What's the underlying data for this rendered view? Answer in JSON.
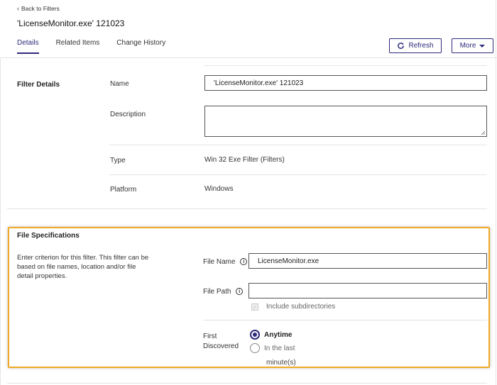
{
  "nav": {
    "back_label": "Back to Filters"
  },
  "page": {
    "title": "'LicenseMonitor.exe' 121023"
  },
  "tabs": [
    {
      "label": "Details",
      "active": true
    },
    {
      "label": "Related Items",
      "active": false
    },
    {
      "label": "Change History",
      "active": false
    }
  ],
  "toolbar": {
    "refresh_label": "Refresh",
    "more_label": "More"
  },
  "filter_details": {
    "section_title": "Filter Details",
    "name_label": "Name",
    "name_value": "'LicenseMonitor.exe' 121023",
    "description_label": "Description",
    "description_value": "",
    "type_label": "Type",
    "type_value": "Win 32 Exe Filter (Filters)",
    "platform_label": "Platform",
    "platform_value": "Windows"
  },
  "file_specifications": {
    "section_title": "File Specifications",
    "description_line1": "Enter criterion for this filter. This filter can be",
    "description_line2": "based on file names, location and/or file",
    "description_line3": "detail properties.",
    "file_name_label": "File Name",
    "file_name_value": "LicenseMonitor.exe",
    "file_path_label": "File Path",
    "file_path_value": "",
    "include_subdirs_label": "Include subdirectories",
    "include_subdirs_checked": true,
    "first_label": "First",
    "discovered_label": "Discovered",
    "option_anytime": "Anytime",
    "option_in_last": "In the last",
    "minutes_label": "minute(s)"
  },
  "colors": {
    "accent": "#2d2a7a",
    "highlight": "#f0a926"
  }
}
